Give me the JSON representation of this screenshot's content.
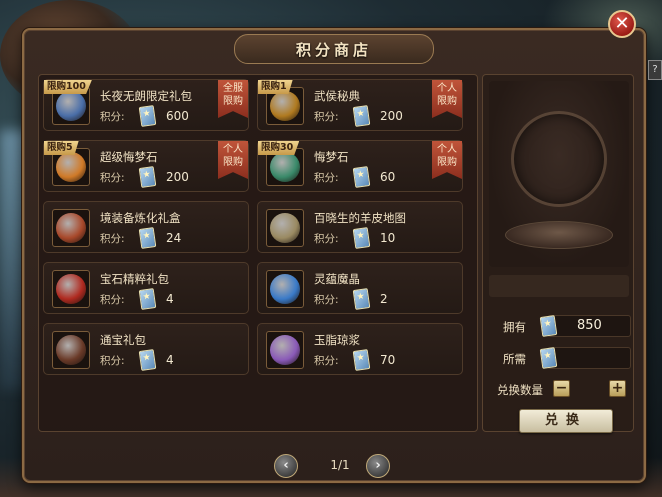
{
  "window": {
    "title": "积分商店",
    "close_icon": "close-icon",
    "help_label": "?"
  },
  "colors": {
    "accent_gold": "#c79a4a",
    "limit_tag_red": "#c0553a",
    "panel_brown": "#2c201b",
    "close_red": "#9b1c16"
  },
  "items": [
    {
      "name": "长夜无朗限定礼包",
      "limit": "限购100",
      "price_label": "积分:",
      "price": "600",
      "tag": "全服限购",
      "icon_color": "#4a6ea8"
    },
    {
      "name": "武侯秘典",
      "limit": "限购1",
      "price_label": "积分:",
      "price": "200",
      "tag": "个人限购",
      "icon_color": "#b07a20"
    },
    {
      "name": "超级悔梦石",
      "limit": "限购5",
      "price_label": "积分:",
      "price": "200",
      "tag": "个人限购",
      "icon_color": "#d07a28"
    },
    {
      "name": "悔梦石",
      "limit": "限购30",
      "price_label": "积分:",
      "price": "60",
      "tag": "个人限购",
      "icon_color": "#3a8a6a"
    },
    {
      "name": "境装备炼化礼盒",
      "limit": "",
      "price_label": "积分:",
      "price": "24",
      "tag": "",
      "icon_color": "#a8482a"
    },
    {
      "name": "百晓生的羊皮地图",
      "limit": "",
      "price_label": "积分:",
      "price": "10",
      "tag": "",
      "icon_color": "#9a8a62"
    },
    {
      "name": "宝石精粹礼包",
      "limit": "",
      "price_label": "积分:",
      "price": "4",
      "tag": "",
      "icon_color": "#b02a20"
    },
    {
      "name": "灵蕴魔晶",
      "limit": "",
      "price_label": "积分:",
      "price": "2",
      "tag": "",
      "icon_color": "#3a7ac8"
    },
    {
      "name": "通宝礼包",
      "limit": "",
      "price_label": "积分:",
      "price": "4",
      "tag": "",
      "icon_color": "#6a3a28"
    },
    {
      "name": "玉脂琼浆",
      "limit": "",
      "price_label": "积分:",
      "price": "70",
      "tag": "",
      "icon_color": "#8a5ab8"
    }
  ],
  "right_panel": {
    "owned_label": "拥有",
    "owned_value": "850",
    "required_label": "所需",
    "required_value": "",
    "quantity_label": "兑换数量",
    "minus_label": "−",
    "plus_label": "+",
    "exchange_label": "兑换"
  },
  "pager": {
    "prev_label": "‹",
    "next_label": "›",
    "page_text": "1/1"
  }
}
